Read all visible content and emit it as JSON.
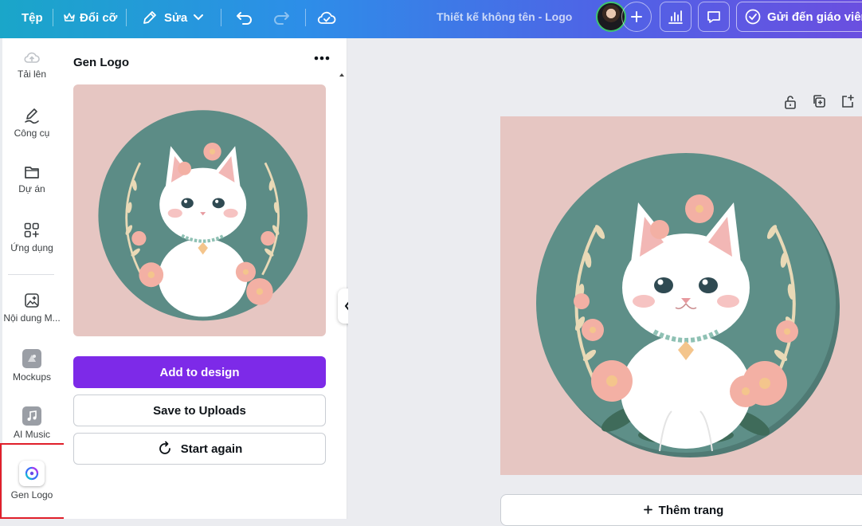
{
  "topbar": {
    "file_label": "Tệp",
    "resize_label": "Đổi cỡ",
    "edit_label": "Sửa",
    "doc_title": "Thiết kế không tên - Logo",
    "send_label": "Gửi đến giáo viên"
  },
  "rail": {
    "items": [
      {
        "label": "Tải lên",
        "icon": "cloud-upload-icon"
      },
      {
        "label": "Công cụ",
        "icon": "pen-icon"
      },
      {
        "label": "Dự án",
        "icon": "folder-icon"
      },
      {
        "label": "Ứng dụng",
        "icon": "apps-icon"
      },
      {
        "label": "Nội dung M...",
        "icon": "magic-image-icon"
      },
      {
        "label": "Mockups",
        "icon": "mockups-icon"
      },
      {
        "label": "AI Music",
        "icon": "music-icon"
      },
      {
        "label": "Gen Logo",
        "icon": "gen-logo-icon"
      }
    ]
  },
  "panel": {
    "title": "Gen Logo",
    "add_to_design": "Add to design",
    "save_to_uploads": "Save to Uploads",
    "start_again": "Start again"
  },
  "canvas": {
    "add_page": "Thêm trang"
  },
  "colors": {
    "accent": "#7d2ae8",
    "logo_background": "#e6c6c2",
    "logo_circle": "#5e8f88",
    "highlight_box": "#e01f2a"
  }
}
